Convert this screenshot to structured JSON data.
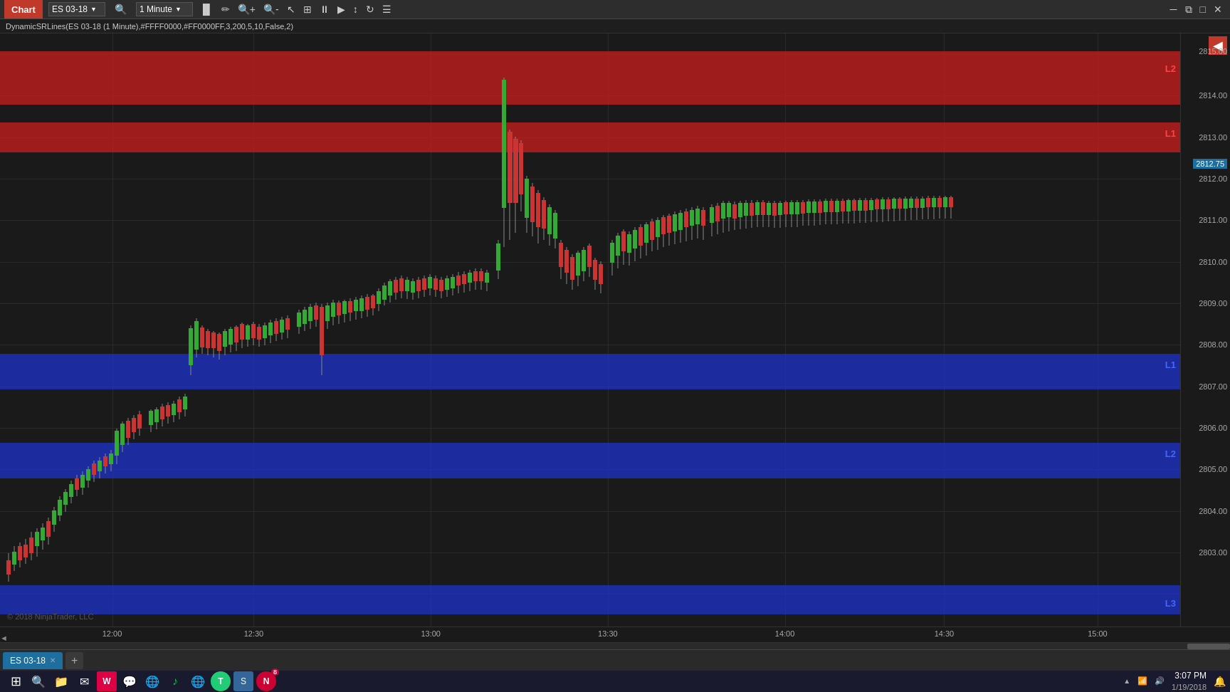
{
  "titlebar": {
    "chart_label": "Chart",
    "symbol": "ES 03-18",
    "timeframe": "1 Minute",
    "timeframe_arrow": "▼",
    "symbol_arrow": "▼"
  },
  "infobar": {
    "text": "DynamicSRLines(ES 03-18 (1 Minute),#FFFF0000,#FF0000FF,3,200,5,10,False,2)"
  },
  "sr_lines": {
    "red_l2_label": "L2",
    "red_l1_label": "L1",
    "blue_l1_label": "L1",
    "blue_l2_label": "L2",
    "blue_l3_label": "L3"
  },
  "prices": {
    "current": "2812.75",
    "levels": [
      "2815.00",
      "2814.00",
      "2813.00",
      "2812.75",
      "2812.00",
      "2811.00",
      "2810.00",
      "2809.00",
      "2808.00",
      "2807.00",
      "2806.00",
      "2805.00",
      "2804.00",
      "2803.00"
    ]
  },
  "times": {
    "labels": [
      "12:00",
      "12:30",
      "13:00",
      "13:30",
      "14:00",
      "14:30",
      "15:00"
    ]
  },
  "copyright": "© 2018 NinjaTrader, LLC",
  "tab": {
    "label": "ES 03-18",
    "add_label": "+"
  },
  "taskbar": {
    "icons": [
      "⊞",
      "🔍",
      "📁",
      "✉",
      "💬",
      "🌐",
      "🎵",
      "🌐",
      "💹",
      "✂"
    ],
    "time": "3:07 PM",
    "date": "1/19/2018",
    "notify_icon": "🔔",
    "ninja_badge": "8"
  }
}
